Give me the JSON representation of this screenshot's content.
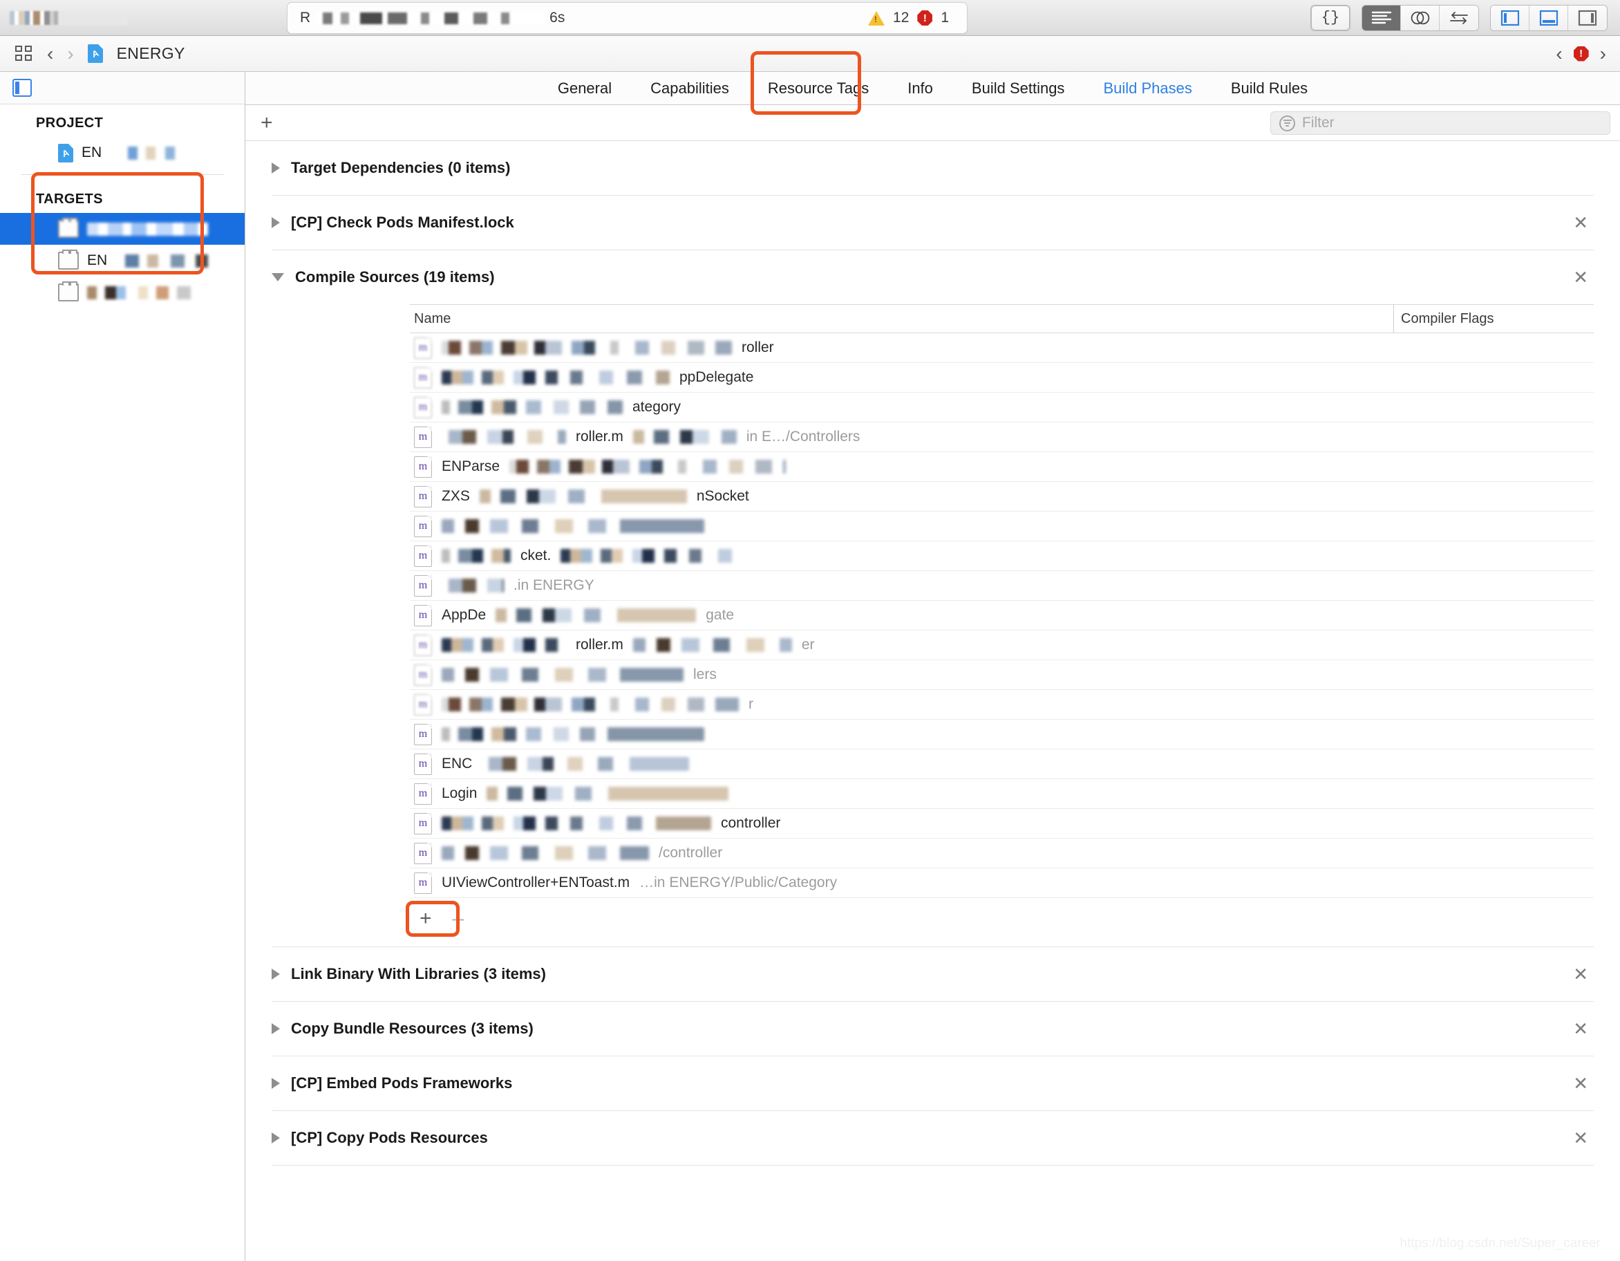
{
  "toolbar": {
    "scheme_prefix": "R",
    "scheme_suffix": "6s",
    "warning_count": "12",
    "error_count": "1",
    "icons": {
      "braces": "{}",
      "standard_editor": "standard-editor-icon",
      "assistant_editor": "assistant-editor-icon",
      "version_editor": "version-editor-icon",
      "navigator_toggle": "left-panel-toggle-icon",
      "debug_toggle": "bottom-panel-toggle-icon",
      "utilities_toggle": "right-panel-toggle-icon"
    }
  },
  "navbar": {
    "breadcrumb": "ENERGY",
    "back": "‹",
    "forward": "›",
    "prev_issue": "‹",
    "next_issue": "›"
  },
  "sidebar": {
    "project_header": "PROJECT",
    "project_item_label": "EN",
    "targets_header": "TARGETS",
    "targets": [
      {
        "label": "",
        "selected": true
      },
      {
        "label": "EN",
        "selected": false
      },
      {
        "label": "",
        "selected": false
      }
    ]
  },
  "tabs": [
    {
      "label": "General",
      "active": false
    },
    {
      "label": "Capabilities",
      "active": false
    },
    {
      "label": "Resource Tags",
      "active": false
    },
    {
      "label": "Info",
      "active": false
    },
    {
      "label": "Build Settings",
      "active": false
    },
    {
      "label": "Build Phases",
      "active": true
    },
    {
      "label": "Build Rules",
      "active": false
    }
  ],
  "phase_toolbar": {
    "add_label": "+",
    "filter_placeholder": "Filter"
  },
  "phases": [
    {
      "title": "Target Dependencies (0 items)",
      "expanded": false,
      "closable": false
    },
    {
      "title": "[CP] Check Pods Manifest.lock",
      "expanded": false,
      "closable": true
    },
    {
      "title": "Compile Sources (19 items)",
      "expanded": true,
      "closable": true
    },
    {
      "title": "Link Binary With Libraries (3 items)",
      "expanded": false,
      "closable": true
    },
    {
      "title": "Copy Bundle Resources (3 items)",
      "expanded": false,
      "closable": true
    },
    {
      "title": "[CP] Embed Pods Frameworks",
      "expanded": false,
      "closable": true
    },
    {
      "title": "[CP] Copy Pods Resources",
      "expanded": false,
      "closable": true
    }
  ],
  "compile_sources": {
    "columns": {
      "name": "Name",
      "flags": "Compiler Flags"
    },
    "add_label": "+",
    "remove_label": "–",
    "rows": [
      {
        "icon": "storyboard-file-icon",
        "name_visible": "",
        "tail": "roller",
        "redact": "r1",
        "redact_width": 420
      },
      {
        "icon": "storyboard-file-icon",
        "name_visible": "",
        "tail": "ppDelegate",
        "redact": "r2",
        "redact_width": 330
      },
      {
        "icon": "storyboard-file-icon",
        "name_visible": "",
        "tail": "ategory",
        "redact": "r3",
        "redact_width": 262
      },
      {
        "icon": "objc-m-file-icon",
        "name_visible": "",
        "tail": "roller.m",
        "path": "in E…/Controllers",
        "redact": "r4",
        "redact_width": 240
      },
      {
        "icon": "objc-m-file-icon",
        "name_visible": "ENParse",
        "tail": "",
        "redact": "r1",
        "redact_width": 400
      },
      {
        "icon": "objc-m-file-icon",
        "name_visible": "ZXS",
        "tail": "nSocket",
        "redact": "r5",
        "redact_width": 300
      },
      {
        "icon": "objc-m-file-icon",
        "name_visible": "",
        "tail": "",
        "redact": "r6",
        "redact_width": 380
      },
      {
        "icon": "objc-m-file-icon",
        "name_visible": "",
        "tail": "cket.",
        "redact": "r3",
        "redact_width": 260
      },
      {
        "icon": "objc-m-file-icon",
        "name_visible": "",
        "tail": ".in ENERGY",
        "redact": "r4",
        "redact_width": 90
      },
      {
        "icon": "objc-m-file-icon",
        "name_visible": "AppDe",
        "tail": "gate",
        "redact": "r5",
        "redact_width": 290
      },
      {
        "icon": "storyboard-file-icon",
        "name_visible": "",
        "tail": "roller.m",
        "tail2": "er",
        "redact": "r2",
        "redact_width": 180
      },
      {
        "icon": "objc-m-file-icon",
        "name_visible": "",
        "tail": "lers",
        "redact": "r6",
        "redact_width": 350
      },
      {
        "icon": "storyboard-file-icon",
        "name_visible": "",
        "tail": "r",
        "redact": "r1",
        "redact_width": 430
      },
      {
        "icon": "objc-m-file-icon",
        "name_visible": "",
        "tail": "",
        "redact": "r3",
        "redact_width": 380
      },
      {
        "icon": "objc-m-file-icon",
        "name_visible": "ENC",
        "tail": "",
        "redact": "r4",
        "redact_width": 300
      },
      {
        "icon": "objc-m-file-icon",
        "name_visible": "Login",
        "tail": "",
        "redact": "r5",
        "redact_width": 350
      },
      {
        "icon": "objc-m-file-icon",
        "name_visible": "",
        "tail": "controller",
        "redact": "r2",
        "redact_width": 390
      },
      {
        "icon": "objc-m-file-icon",
        "name_visible": "",
        "tail": "/controller",
        "redact": "r6",
        "redact_width": 300
      },
      {
        "icon": "objc-m-file-icon",
        "name_visible": "UIViewController+ENToast.m",
        "tail": "",
        "path": "…in ENERGY/Public/Category",
        "redact": "",
        "redact_width": 0
      }
    ]
  },
  "watermark": "https://blog.csdn.net/Super_career"
}
